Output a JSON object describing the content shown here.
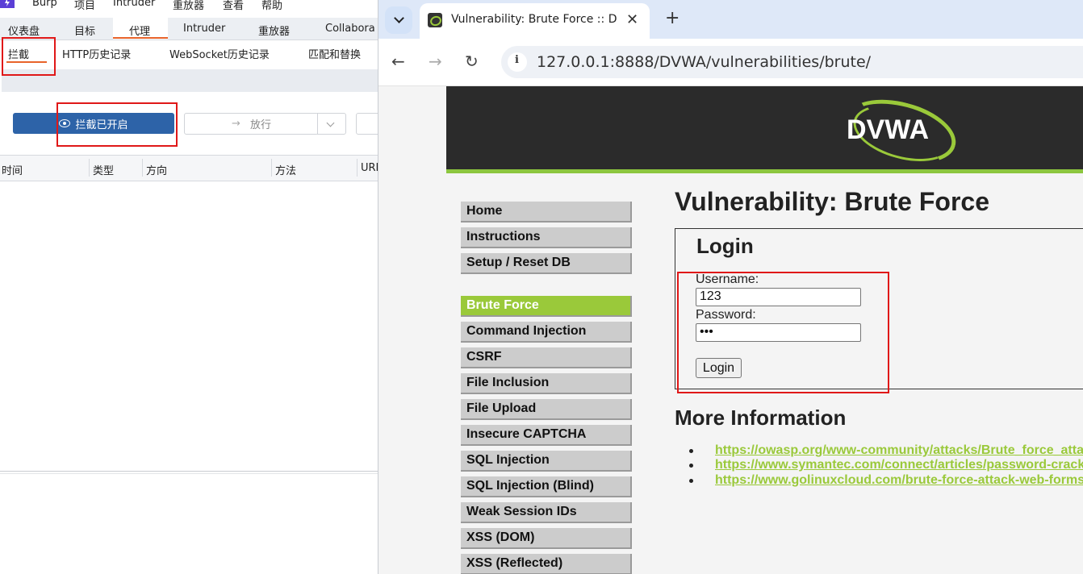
{
  "burp": {
    "menu": [
      "Burp",
      "项目",
      "Intruder",
      "重放器",
      "查看",
      "帮助"
    ],
    "tabs": [
      "仪表盘",
      "目标",
      "代理",
      "Intruder",
      "重放器",
      "Collabora"
    ],
    "active_tab": "代理",
    "subtabs": [
      "拦截",
      "HTTP历史记录",
      "WebSocket历史记录",
      "匹配和替换"
    ],
    "active_subtab": "拦截",
    "intercept_button": "拦截已开启",
    "forward_button": "放行",
    "columns": [
      "时间",
      "类型",
      "方向",
      "方法",
      "URL"
    ],
    "accent_color": "#e8632a",
    "button_color": "#2d63a8"
  },
  "browser": {
    "tab_title": "Vulnerability: Brute Force :: D",
    "url": "127.0.0.1:8888/DVWA/vulnerabilities/brute/",
    "icons": [
      "tab-list-icon",
      "favicon",
      "close-icon",
      "new-tab-icon",
      "back-icon",
      "forward-icon",
      "reload-icon",
      "site-info-icon"
    ]
  },
  "dvwa": {
    "logo": "DVWA",
    "menu": [
      "Home",
      "Instructions",
      "Setup / Reset DB",
      "Brute Force",
      "Command Injection",
      "CSRF",
      "File Inclusion",
      "File Upload",
      "Insecure CAPTCHA",
      "SQL Injection",
      "SQL Injection (Blind)",
      "Weak Session IDs",
      "XSS (DOM)",
      "XSS (Reflected)"
    ],
    "selected": "Brute Force",
    "page_title": "Vulnerability: Brute Force",
    "login": {
      "heading": "Login",
      "username_label": "Username:",
      "username_value": "123",
      "password_label": "Password:",
      "password_value": "•••",
      "submit": "Login"
    },
    "more_info_title": "More Information",
    "links": [
      "https://owasp.org/www-community/attacks/Brute_force_attack",
      "https://www.symantec.com/connect/articles/password-crackers-ensuring-security-your-password",
      "https://www.golinuxcloud.com/brute-force-attack-web-forms"
    ],
    "accent_color": "#9ac93a"
  }
}
